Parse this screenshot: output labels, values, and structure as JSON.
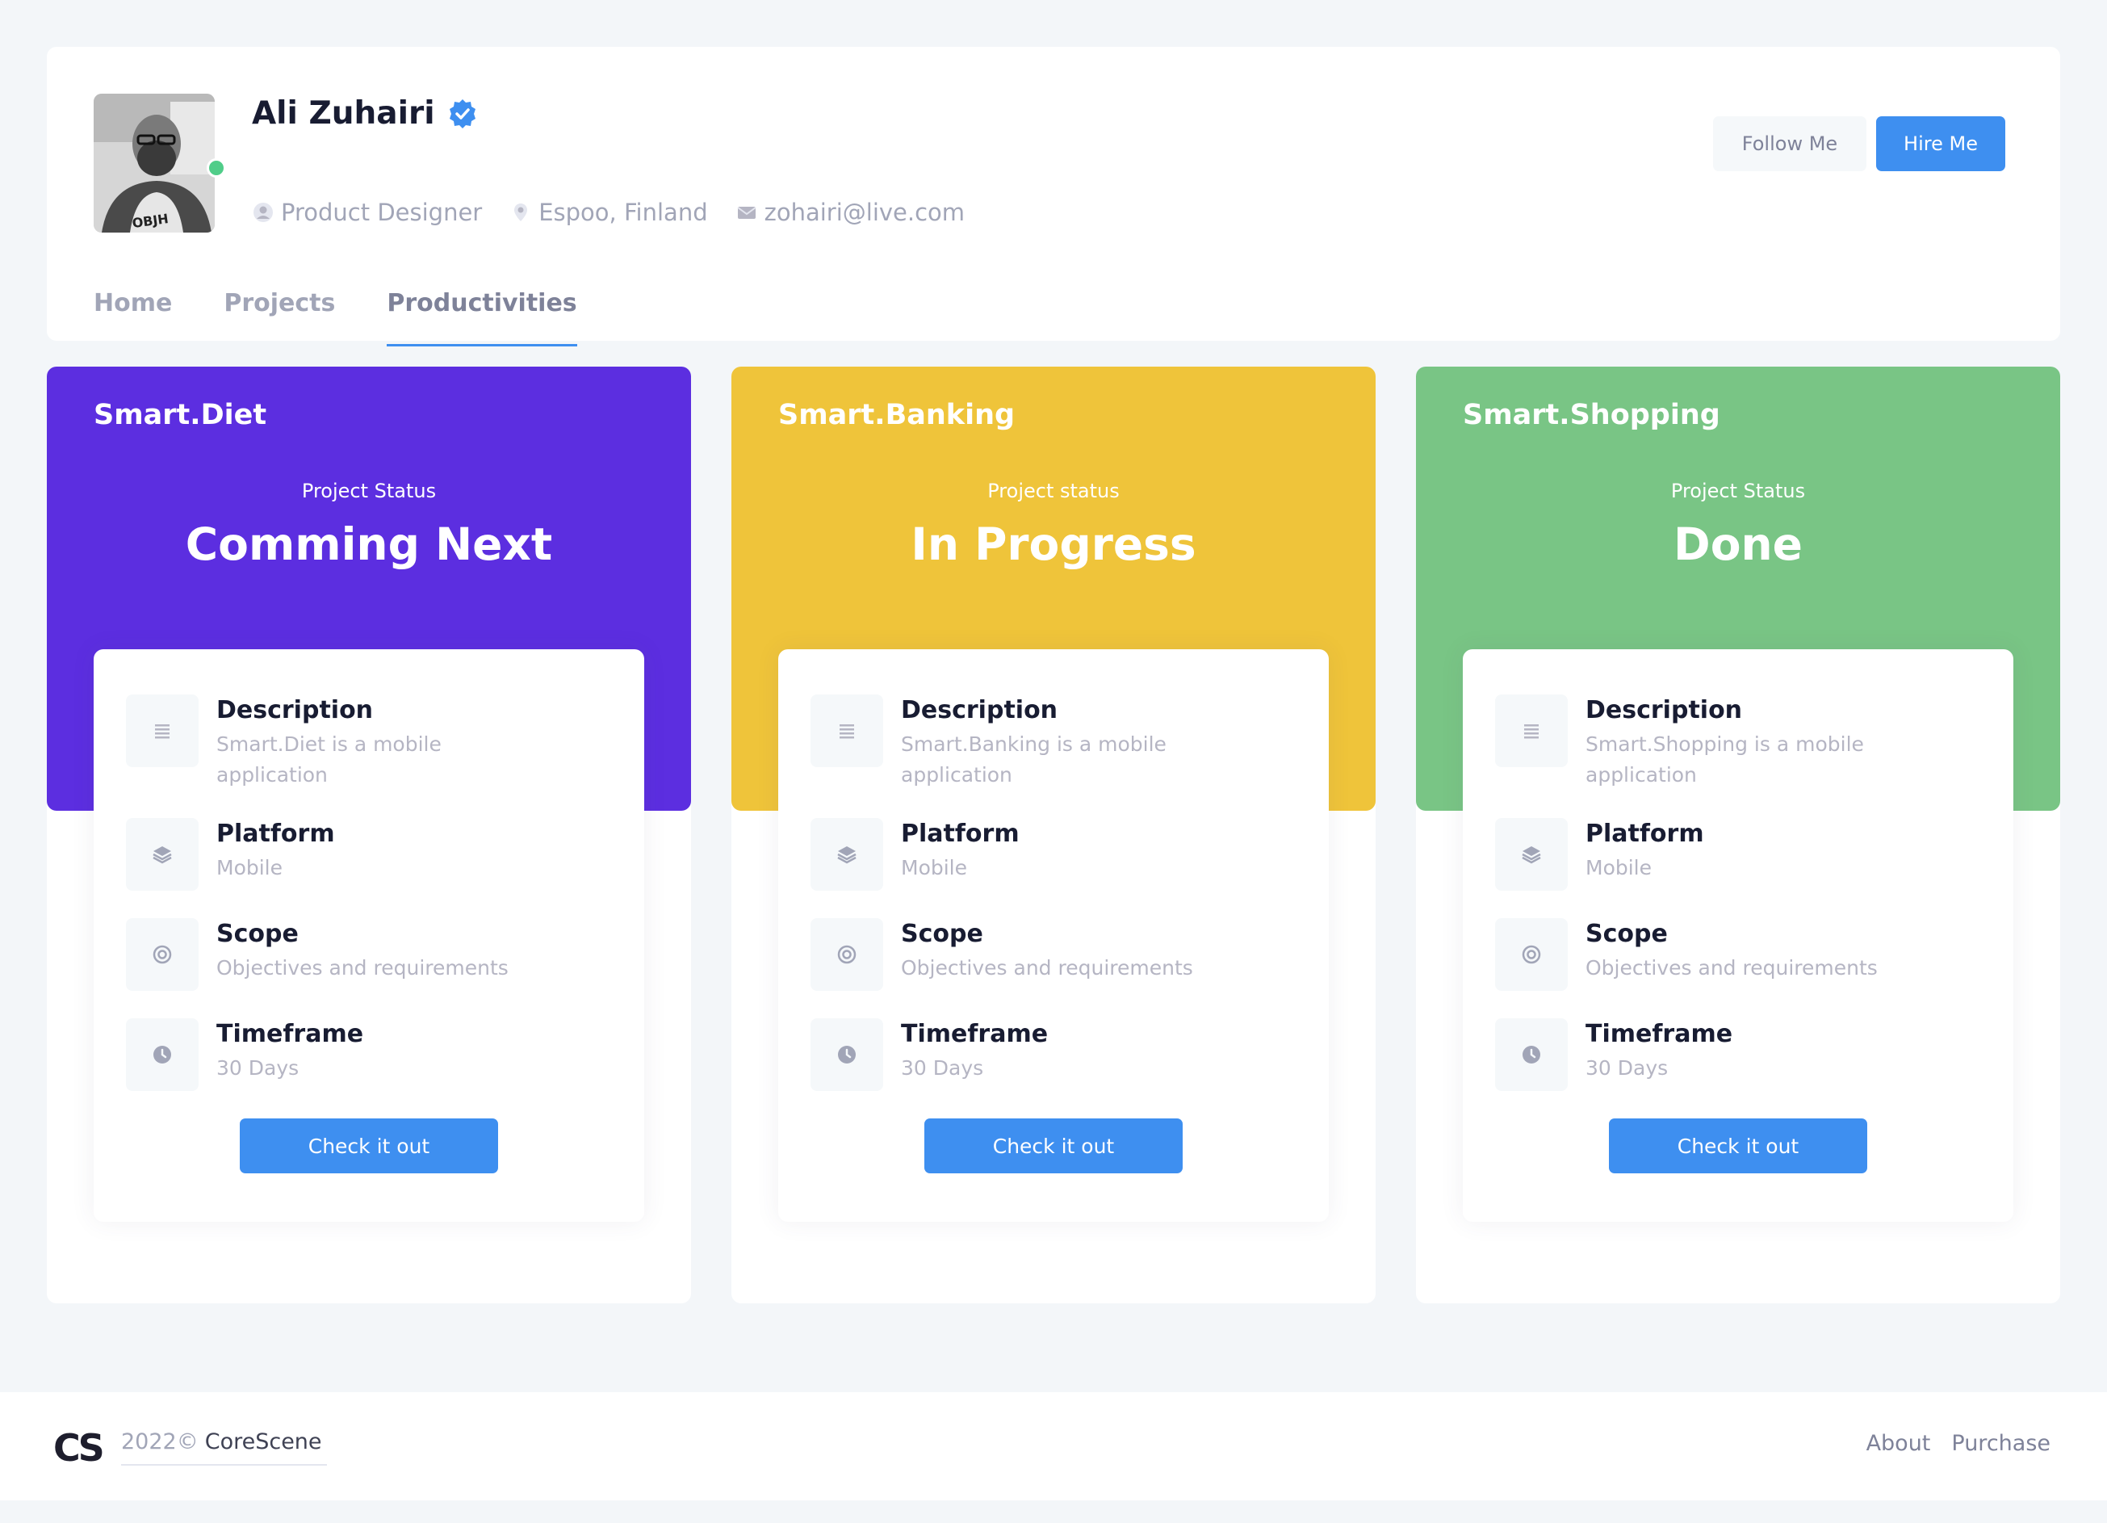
{
  "profile": {
    "name": "Ali Zuhairi",
    "role": "Product Designer",
    "location": "Espoo, Finland",
    "email": "zohairi@live.com",
    "avatar_shirt_text": "OBJH",
    "online": true
  },
  "actions": {
    "follow_label": "Follow Me",
    "hire_label": "Hire Me"
  },
  "tabs": [
    {
      "label": "Home",
      "active": false
    },
    {
      "label": "Projects",
      "active": false
    },
    {
      "label": "Productivities",
      "active": true
    }
  ],
  "projects": [
    {
      "title": "Smart.Diet",
      "status_label": "Project Status",
      "status": "Comming Next",
      "color": "#5c2ee0",
      "items": [
        {
          "title": "Description",
          "value": "Smart.Diet is a mobile application",
          "icon": "list-icon"
        },
        {
          "title": "Platform",
          "value": "Mobile",
          "icon": "layers-icon"
        },
        {
          "title": "Scope",
          "value": "Objectives and requirements",
          "icon": "target-icon"
        },
        {
          "title": "Timeframe",
          "value": "30 Days",
          "icon": "clock-icon"
        }
      ],
      "button": "Check it out"
    },
    {
      "title": "Smart.Banking",
      "status_label": "Project status",
      "status": "In Progress",
      "color": "#efc43a",
      "items": [
        {
          "title": "Description",
          "value": "Smart.Banking is a mobile application",
          "icon": "list-icon"
        },
        {
          "title": "Platform",
          "value": "Mobile",
          "icon": "layers-icon"
        },
        {
          "title": "Scope",
          "value": "Objectives and requirements",
          "icon": "target-icon"
        },
        {
          "title": "Timeframe",
          "value": "30 Days",
          "icon": "clock-icon"
        }
      ],
      "button": "Check it out"
    },
    {
      "title": "Smart.Shopping",
      "status_label": "Project Status",
      "status": "Done",
      "color": "#79c585",
      "items": [
        {
          "title": "Description",
          "value": "Smart.Shopping is a mobile application",
          "icon": "list-icon"
        },
        {
          "title": "Platform",
          "value": "Mobile",
          "icon": "layers-icon"
        },
        {
          "title": "Scope",
          "value": "Objectives and requirements",
          "icon": "target-icon"
        },
        {
          "title": "Timeframe",
          "value": "30 Days",
          "icon": "clock-icon"
        }
      ],
      "button": "Check it out"
    }
  ],
  "footer": {
    "logo": "CS",
    "year": "2022©",
    "brand": "CoreScene",
    "links": [
      "About",
      "Purchase"
    ]
  },
  "colors": {
    "primary": "#3e8ff0",
    "online": "#50cd89",
    "page_bg": "#f3f6f9"
  }
}
